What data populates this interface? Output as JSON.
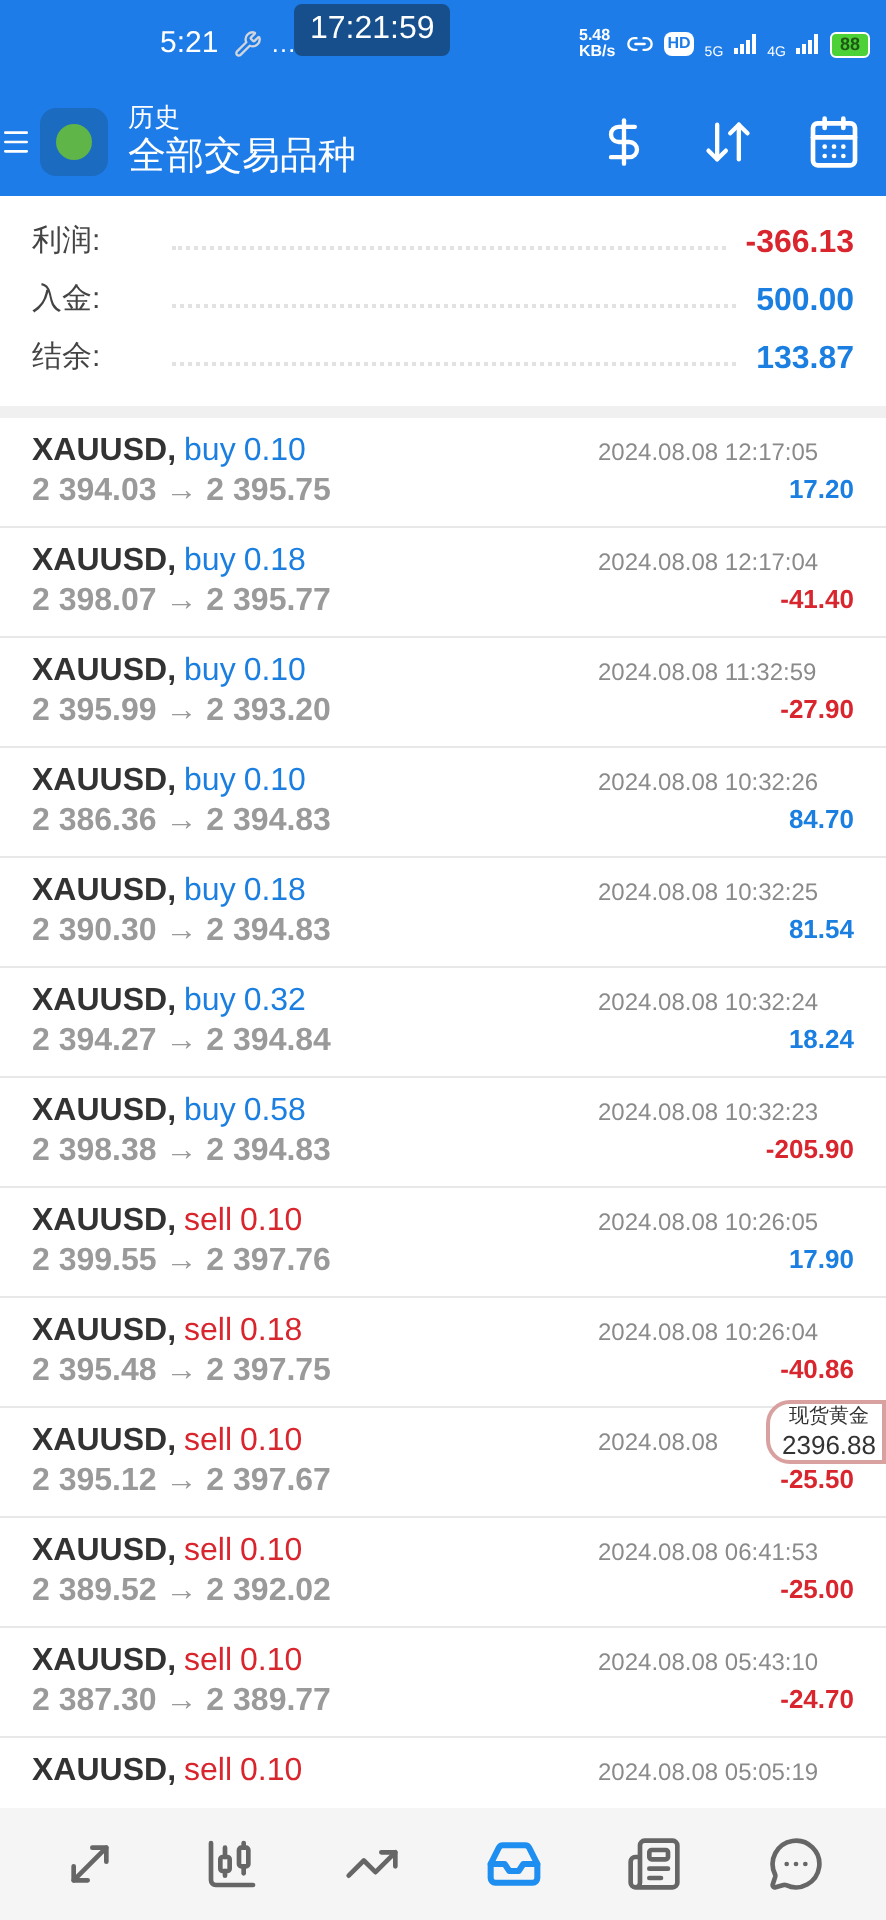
{
  "status_bar": {
    "time": "5:21",
    "more": "…",
    "clock_badge": "17:21:59",
    "speed": "5.48",
    "speed_unit": "KB/s",
    "hd": "HD",
    "net1": "5G",
    "net2": "4G",
    "battery": "88"
  },
  "header": {
    "subtitle": "历史",
    "title": "全部交易品种"
  },
  "summary": [
    {
      "label": "利润:",
      "value": "-366.13",
      "negative": true
    },
    {
      "label": "入金:",
      "value": "500.00",
      "negative": false
    },
    {
      "label": "结余:",
      "value": "133.87",
      "negative": false
    }
  ],
  "trades": [
    {
      "symbol": "XAUUSD,",
      "side": "buy",
      "volume": "0.10",
      "prices": "2 394.03 → 2 395.75",
      "time": "2024.08.08 12:17:05",
      "profit": "17.20",
      "negative": false
    },
    {
      "symbol": "XAUUSD,",
      "side": "buy",
      "volume": "0.18",
      "prices": "2 398.07 → 2 395.77",
      "time": "2024.08.08 12:17:04",
      "profit": "-41.40",
      "negative": true
    },
    {
      "symbol": "XAUUSD,",
      "side": "buy",
      "volume": "0.10",
      "prices": "2 395.99 → 2 393.20",
      "time": "2024.08.08 11:32:59",
      "profit": "-27.90",
      "negative": true
    },
    {
      "symbol": "XAUUSD,",
      "side": "buy",
      "volume": "0.10",
      "prices": "2 386.36 → 2 394.83",
      "time": "2024.08.08 10:32:26",
      "profit": "84.70",
      "negative": false
    },
    {
      "symbol": "XAUUSD,",
      "side": "buy",
      "volume": "0.18",
      "prices": "2 390.30 → 2 394.83",
      "time": "2024.08.08 10:32:25",
      "profit": "81.54",
      "negative": false
    },
    {
      "symbol": "XAUUSD,",
      "side": "buy",
      "volume": "0.32",
      "prices": "2 394.27 → 2 394.84",
      "time": "2024.08.08 10:32:24",
      "profit": "18.24",
      "negative": false
    },
    {
      "symbol": "XAUUSD,",
      "side": "buy",
      "volume": "0.58",
      "prices": "2 398.38 → 2 394.83",
      "time": "2024.08.08 10:32:23",
      "profit": "-205.90",
      "negative": true
    },
    {
      "symbol": "XAUUSD,",
      "side": "sell",
      "volume": "0.10",
      "prices": "2 399.55 → 2 397.76",
      "time": "2024.08.08 10:26:05",
      "profit": "17.90",
      "negative": false
    },
    {
      "symbol": "XAUUSD,",
      "side": "sell",
      "volume": "0.18",
      "prices": "2 395.48 → 2 397.75",
      "time": "2024.08.08 10:26:04",
      "profit": "-40.86",
      "negative": true
    },
    {
      "symbol": "XAUUSD,",
      "side": "sell",
      "volume": "0.10",
      "prices": "2 395.12 → 2 397.67",
      "time": "2024.08.08",
      "profit": "-25.50",
      "negative": true
    },
    {
      "symbol": "XAUUSD,",
      "side": "sell",
      "volume": "0.10",
      "prices": "2 389.52 → 2 392.02",
      "time": "2024.08.08 06:41:53",
      "profit": "-25.00",
      "negative": true
    },
    {
      "symbol": "XAUUSD,",
      "side": "sell",
      "volume": "0.10",
      "prices": "2 387.30 → 2 389.77",
      "time": "2024.08.08 05:43:10",
      "profit": "-24.70",
      "negative": true
    },
    {
      "symbol": "XAUUSD,",
      "side": "sell",
      "volume": "0.10",
      "time": "2024.08.08 05:05:19"
    }
  ],
  "floating_quote": {
    "name": "现货黄金",
    "price": "2396.88"
  },
  "bottom_nav": [
    {
      "kind": "trade",
      "selected": false
    },
    {
      "kind": "quotes",
      "selected": false
    },
    {
      "kind": "charts",
      "selected": false
    },
    {
      "kind": "history",
      "selected": true
    },
    {
      "kind": "news",
      "selected": false
    },
    {
      "kind": "chat",
      "selected": false
    }
  ]
}
